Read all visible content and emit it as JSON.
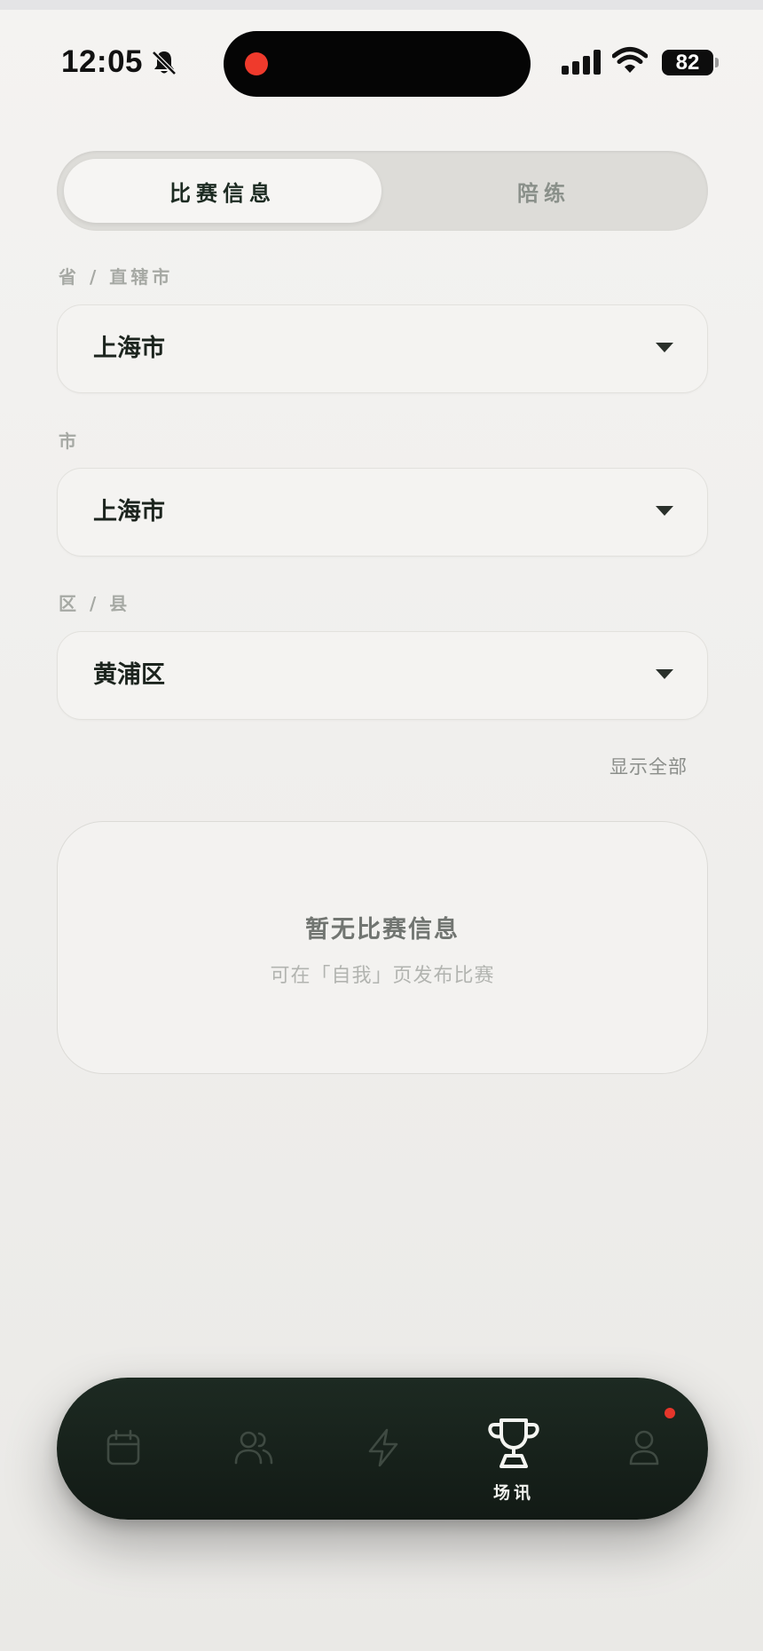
{
  "status_bar": {
    "time": "12:05",
    "battery": "82",
    "icons": [
      "bell-slash-icon",
      "cellular-signal-icon",
      "wifi-icon",
      "battery-icon"
    ]
  },
  "segmented": {
    "tabs": [
      {
        "label": "比赛信息",
        "active": true
      },
      {
        "label": "陪练",
        "active": false
      }
    ]
  },
  "filters": {
    "province": {
      "label": "省 / 直辖市",
      "value": "上海市"
    },
    "city": {
      "label": "市",
      "value": "上海市"
    },
    "district": {
      "label": "区 / 县",
      "value": "黄浦区"
    },
    "show_all": "显示全部"
  },
  "empty_state": {
    "title": "暂无比赛信息",
    "subtitle": "可在「自我」页发布比赛"
  },
  "tabbar": {
    "items": [
      {
        "icon": "calendar-icon",
        "label": "",
        "active": false
      },
      {
        "icon": "users-icon",
        "label": "",
        "active": false
      },
      {
        "icon": "lightning-icon",
        "label": "",
        "active": false
      },
      {
        "icon": "trophy-icon",
        "label": "场讯",
        "active": true
      },
      {
        "icon": "user-icon",
        "label": "",
        "active": false,
        "badge": true
      }
    ]
  },
  "colors": {
    "background": "#f1f0ee",
    "tabbar": "#18231c",
    "accent_red": "#e6362b",
    "text_primary": "#1c241e",
    "text_muted": "#a6a9a4"
  }
}
